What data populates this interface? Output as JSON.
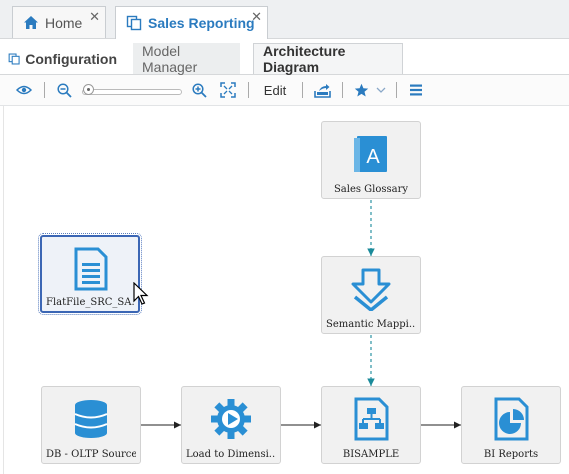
{
  "tabs": [
    {
      "label": "Home"
    },
    {
      "label": "Sales Reporting"
    }
  ],
  "subtabs": [
    {
      "label": "Configuration"
    },
    {
      "label": "Model Manager"
    },
    {
      "label": "Architecture Diagram"
    }
  ],
  "toolbar": {
    "edit_label": "Edit",
    "zoom_level": 0.0
  },
  "nodes": {
    "glossary": {
      "label": "Sales Glossary",
      "icon": "book-icon"
    },
    "flatfile": {
      "label": "FlatFile_SRC_SA...",
      "icon": "document-icon"
    },
    "semantic": {
      "label": "Semantic Mappi...",
      "icon": "download-arrow-icon"
    },
    "db": {
      "label": "DB - OLTP Source",
      "icon": "database-icon"
    },
    "load": {
      "label": "Load to Dimensi...",
      "icon": "gear-play-icon"
    },
    "bisample": {
      "label": "BISAMPLE",
      "icon": "hierarchy-document-icon"
    },
    "bireports": {
      "label": "BI Reports",
      "icon": "pie-chart-document-icon"
    }
  },
  "colors": {
    "accent": "#2b7bbf",
    "icon_blue": "#2a8fd4",
    "dashed_link": "#1a8a9a"
  }
}
